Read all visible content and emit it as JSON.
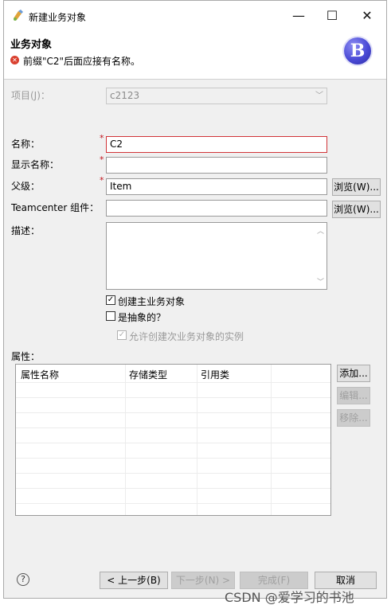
{
  "window": {
    "title": "新建业务对象",
    "minimize": "—",
    "maximize": "☐",
    "close": "✕"
  },
  "header": {
    "title": "业务对象",
    "error_message": "前缀\"C2\"后面应接有名称。",
    "logo_letter": "B"
  },
  "form": {
    "project_label": "项目(J)：",
    "project_value": "c2123",
    "name_label": "名称：",
    "name_value": "C2",
    "display_name_label": "显示名称：",
    "display_name_value": "",
    "parent_label": "父级：",
    "parent_value": "Item",
    "teamcenter_component_label": "Teamcenter 组件：",
    "teamcenter_component_value": "",
    "description_label": "描述：",
    "description_value": "",
    "browse_label": "浏览(W)...",
    "required_mark": "*"
  },
  "options": {
    "create_primary_label": "创建主业务对象",
    "create_primary_checked": true,
    "abstract_label": "是抽象的？",
    "abstract_checked": false,
    "allow_secondary_label": "允许创建次业务对象的实例",
    "allow_secondary_checked": true
  },
  "properties": {
    "section_label": "属性：",
    "columns": [
      "属性名称",
      "存储类型",
      "引用类"
    ],
    "add_label": "添加...",
    "edit_label": "编辑...",
    "remove_label": "移除..."
  },
  "footer": {
    "back_label": "< 上一步(B)",
    "next_label": "下一步(N) >",
    "finish_label": "完成(F)",
    "cancel_label": "取消"
  },
  "watermark": "CSDN @爱学习的书池"
}
